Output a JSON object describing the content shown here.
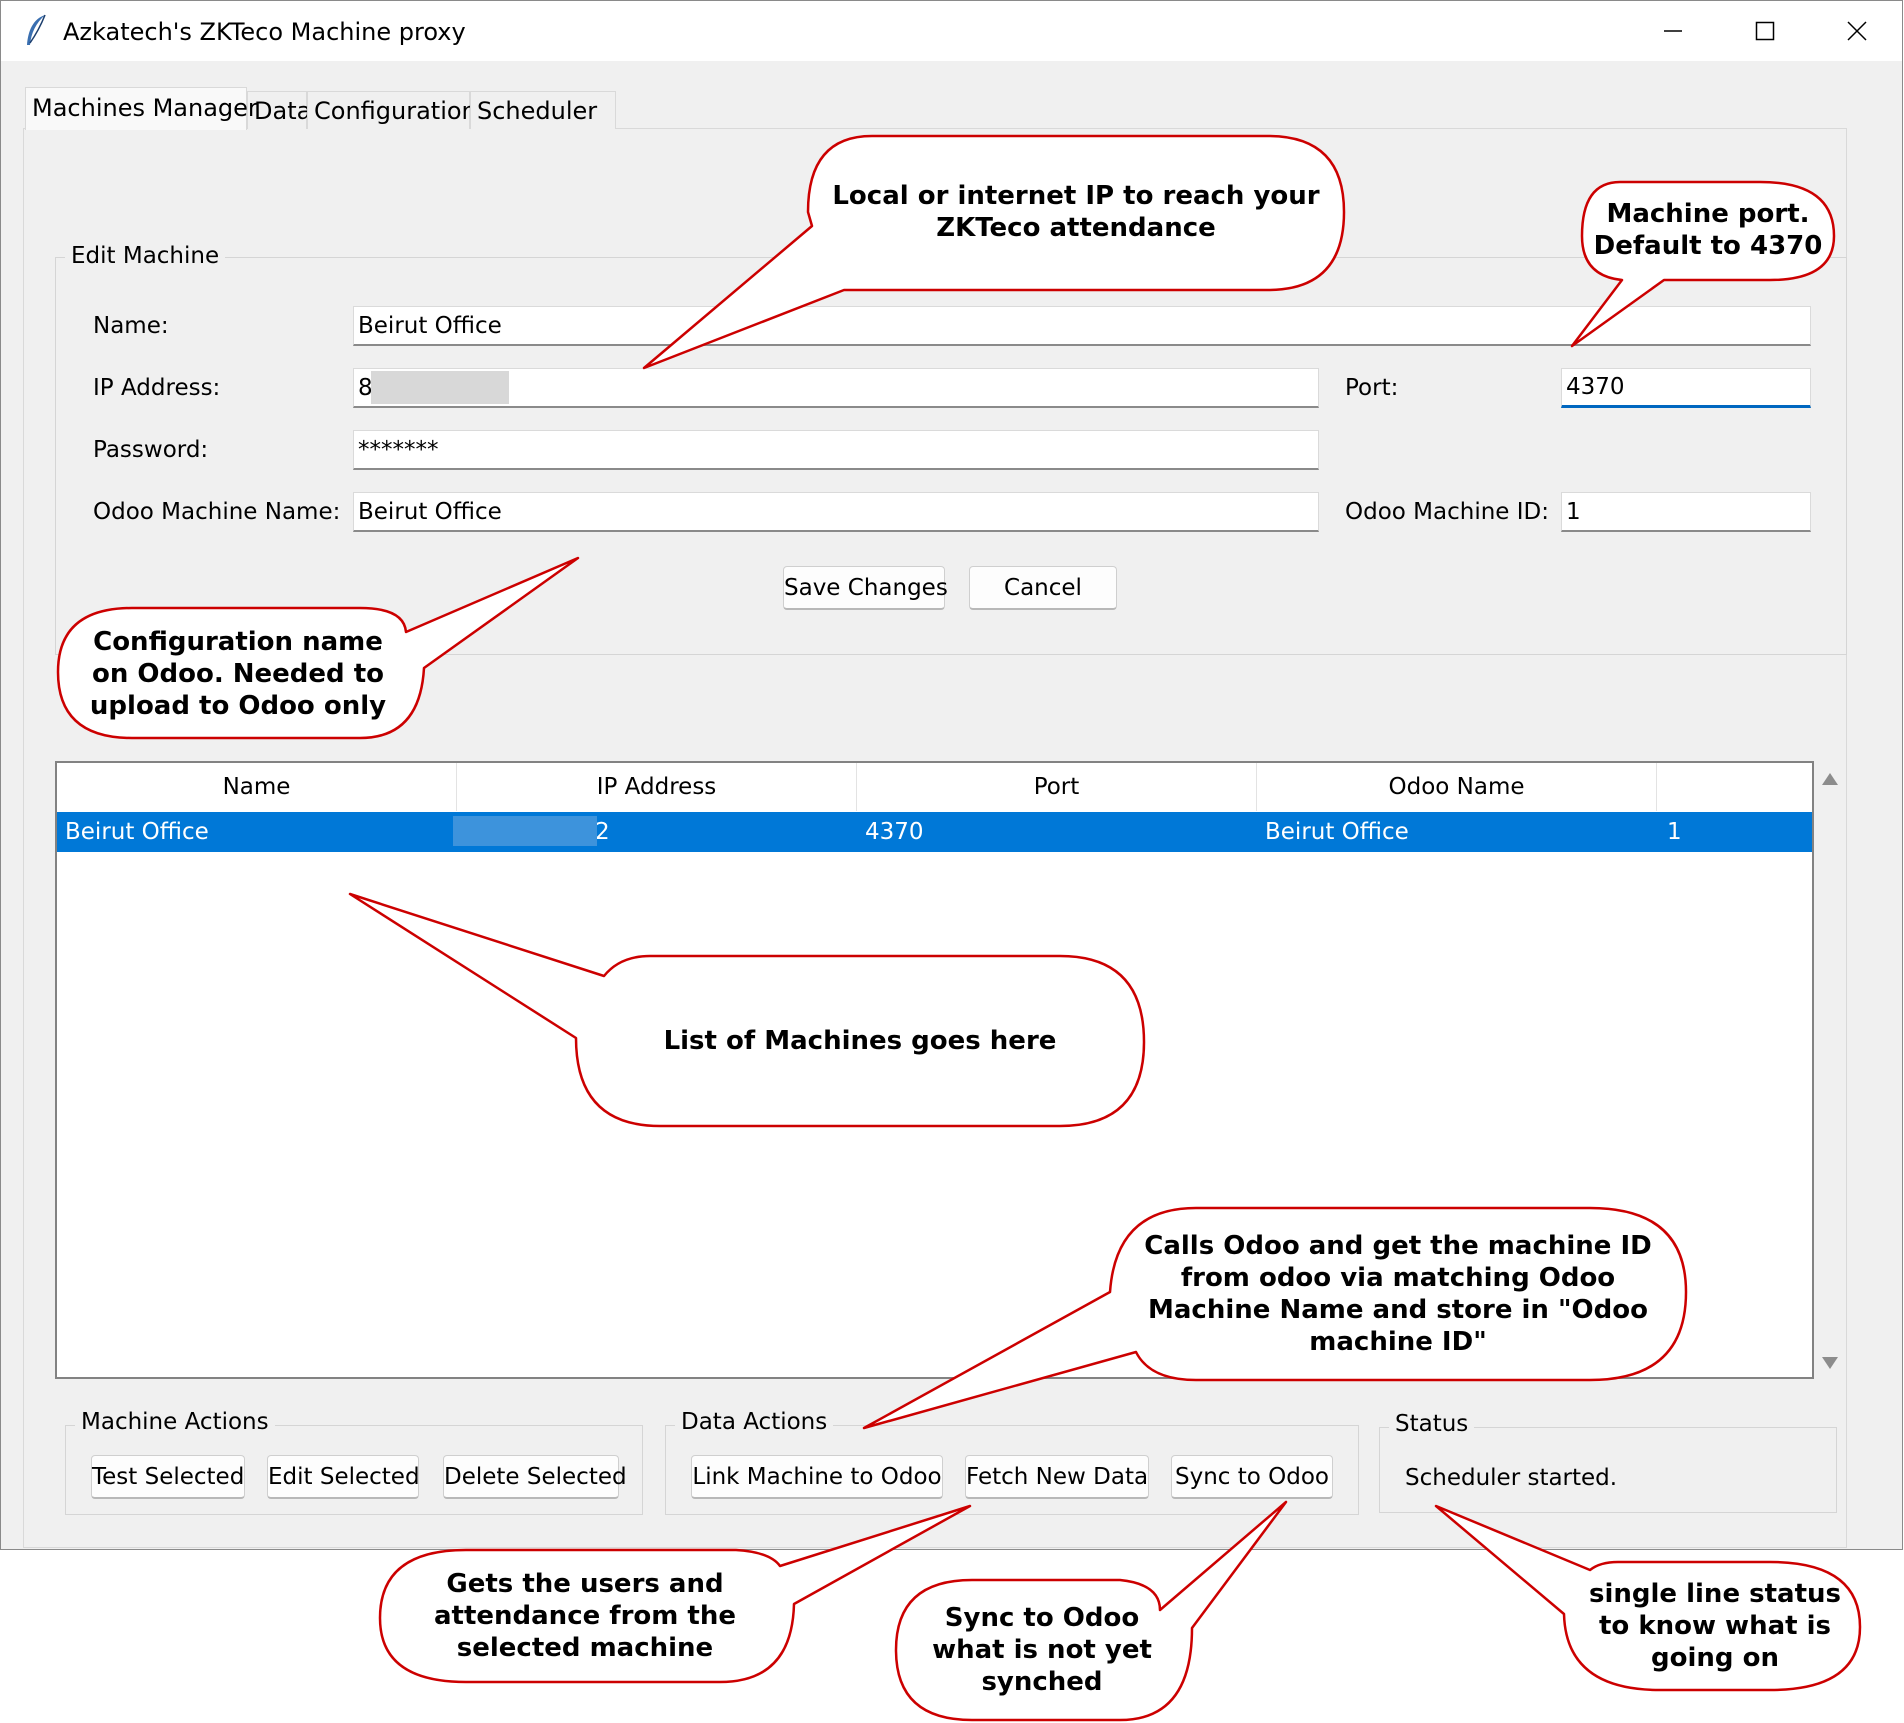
{
  "window": {
    "title": "Azkatech's ZKTeco Machine proxy",
    "app_icon": "feather-icon"
  },
  "window_controls": {
    "minimize_icon": "minimize-icon",
    "maximize_icon": "maximize-icon",
    "close_icon": "close-icon"
  },
  "tabs": [
    {
      "label": "Machines Manager",
      "active": true
    },
    {
      "label": "Data",
      "active": false
    },
    {
      "label": "Configuration",
      "active": false
    },
    {
      "label": "Scheduler",
      "active": false
    }
  ],
  "edit_machine": {
    "group_label": "Edit Machine",
    "name_label": "Name:",
    "name_value": "Beirut Office",
    "ip_label": "IP Address:",
    "ip_value": "8",
    "port_label": "Port:",
    "port_value": "4370",
    "password_label": "Password:",
    "password_value": "*******",
    "odoo_name_label": "Odoo Machine Name:",
    "odoo_name_value": "Beirut Office",
    "odoo_id_label": "Odoo Machine ID:",
    "odoo_id_value": "1",
    "save_label": "Save Changes",
    "cancel_label": "Cancel"
  },
  "machines_table": {
    "columns": [
      "Name",
      "IP Address",
      "Port",
      "Odoo Name",
      ""
    ],
    "rows": [
      {
        "name": "Beirut Office",
        "ip": "2",
        "port": "4370",
        "odoo_name": "Beirut Office",
        "odoo_id": "1",
        "selected": true
      }
    ]
  },
  "machine_actions": {
    "group_label": "Machine Actions",
    "test_label": "Test Selected",
    "edit_label": "Edit Selected",
    "delete_label": "Delete Selected"
  },
  "data_actions": {
    "group_label": "Data Actions",
    "link_label": "Link Machine to Odoo",
    "fetch_label": "Fetch New Data",
    "sync_label": "Sync to Odoo"
  },
  "status": {
    "group_label": "Status",
    "text": "Scheduler started."
  },
  "callouts": {
    "ip": "Local or internet IP to reach your\nZKTeco attendance",
    "port": "Machine port.\nDefault to 4370",
    "odoo_name": "Configuration name\non Odoo. Needed to\nupload to Odoo only",
    "list": "List of Machines goes here",
    "link": "Calls Odoo and get the machine ID\nfrom odoo via matching Odoo\nMachine Name and store in \"Odoo\nmachine ID\"",
    "fetch": "Gets the users and\nattendance from the\nselected machine",
    "sync": "Sync to Odoo\nwhat is not yet\nsynched",
    "status": "single line status\nto know what is\ngoing on"
  },
  "colors": {
    "accent": "#0078d7",
    "callout_border": "#cc0000",
    "focus": "#0067c0"
  }
}
